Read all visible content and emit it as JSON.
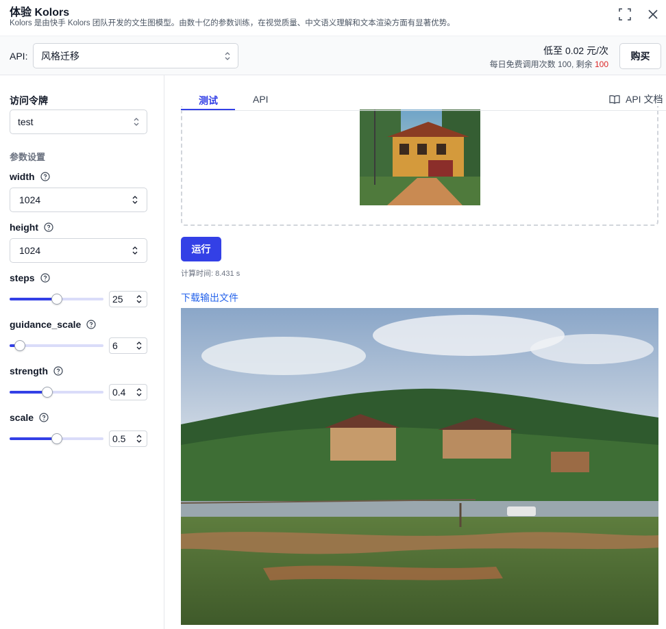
{
  "header": {
    "title": "体验  Kolors",
    "subtitle": "Kolors 是由快手 Kolors 团队开发的文生图模型。由数十亿的参数训练，在视觉质量、中文语义理解和文本渲染方面有显著优势。",
    "expand_icon": "expand-icon",
    "close_icon": "close-icon"
  },
  "api_bar": {
    "label": "API:",
    "selected": "风格迁移",
    "price": "低至 0.02 元/次",
    "quota_prefix": "每日免费调用次数 100, 剩余 ",
    "quota_remaining": "100",
    "buy_label": "购买",
    "remaining_color": "#dc2626"
  },
  "sidebar": {
    "token_heading": "访问令牌",
    "token_value": "test",
    "params_heading": "参数设置",
    "width": {
      "label": "width",
      "value": "1024"
    },
    "height": {
      "label": "height",
      "value": "1024"
    },
    "steps": {
      "label": "steps",
      "value": "25",
      "fraction": 0.5
    },
    "guidance_scale": {
      "label": "guidance_scale",
      "value": "6",
      "fraction": 0.11
    },
    "strength": {
      "label": "strength",
      "value": "0.4",
      "fraction": 0.4
    },
    "scale": {
      "label": "scale",
      "value": "0.5",
      "fraction": 0.5
    }
  },
  "main": {
    "tabs": [
      {
        "label": "测试",
        "active": true
      },
      {
        "label": "API",
        "active": false
      }
    ],
    "api_doc_label": "API 文档",
    "run_label": "运行",
    "calc_time": "计算时间: 8.431 s",
    "download_label": "下载输出文件"
  },
  "colors": {
    "accent": "#3340e6",
    "link": "#2563eb"
  }
}
